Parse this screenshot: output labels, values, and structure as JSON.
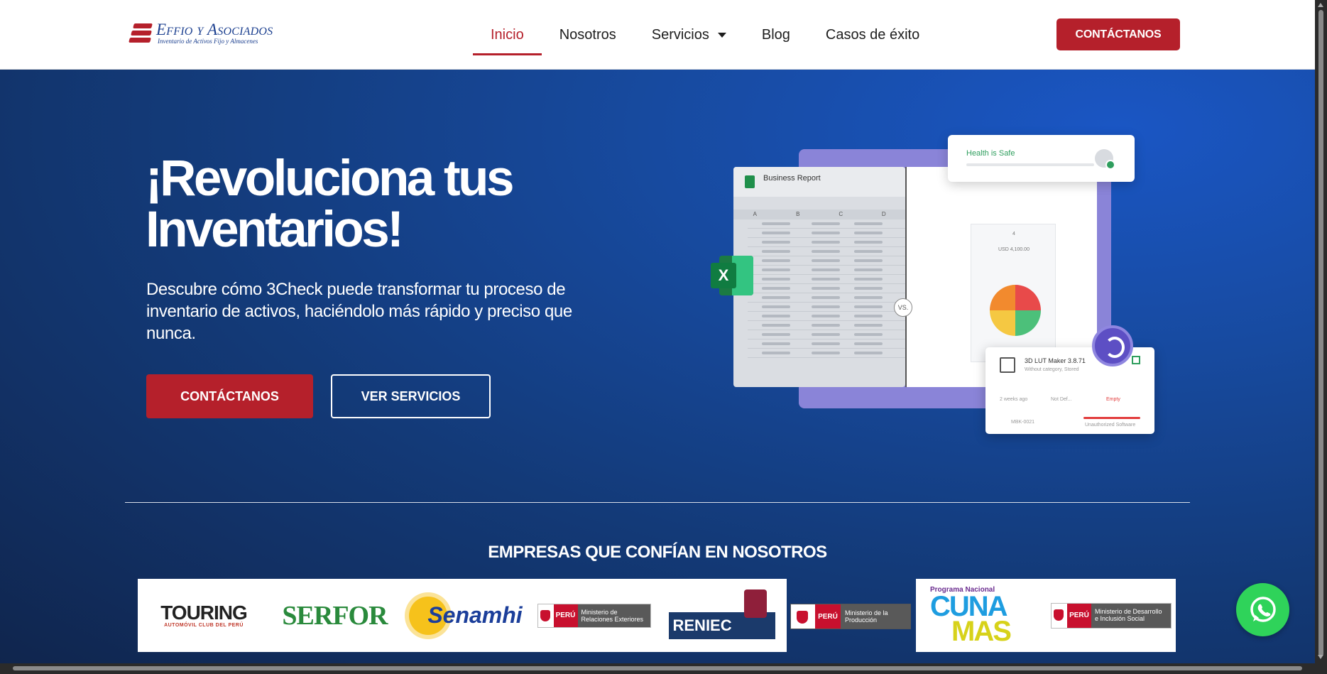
{
  "header": {
    "logo_name": "Effio y Asociados",
    "logo_tagline": "Inventario de Activos Fijo y Almacenes",
    "nav": [
      {
        "label": "Inicio",
        "active": true
      },
      {
        "label": "Nosotros",
        "active": false
      },
      {
        "label": "Servicios",
        "active": false,
        "dropdown": true
      },
      {
        "label": "Blog",
        "active": false
      },
      {
        "label": "Casos de éxito",
        "active": false
      }
    ],
    "cta_label": "CONTÁCTANOS"
  },
  "hero": {
    "title": "¡Revoluciona tus Inventarios!",
    "description": "Descubre cómo 3Check puede transformar tu proceso de inventario de activos, haciéndolo más rápido y preciso que nunca.",
    "primary_button": "CONTÁCTANOS",
    "secondary_button": "VER SERVICIOS"
  },
  "illustration": {
    "sheet_title": "Business Report",
    "sheet_columns": [
      "A",
      "B",
      "C",
      "D"
    ],
    "health_text": "Health is Safe",
    "vs_label": "VS.",
    "dash_total_assets": "4",
    "dash_value": "USD 4,100.00",
    "software_title": "3D LUT Maker 3.8.71",
    "software_sub": "Without category, Stored",
    "software_installed": "2 weeks ago",
    "software_manuf": "Not Def...",
    "software_license": "Empty",
    "software_id": "MBK-0021",
    "software_status": "Unauthorized Software",
    "excel_letter": "X"
  },
  "trust": {
    "title": "EMPRESAS QUE CONFÍAN EN NOSOTROS",
    "logos": {
      "touring_main": "TOURING",
      "touring_sub": "AUTOMÓVIL CLUB DEL PERÚ",
      "serfor": "SERFOR",
      "senamhi": "Senamhi",
      "peru_label": "PERÚ",
      "mrree": "Ministerio de Relaciones Exteriores",
      "reniec": "RENIEC",
      "produccion": "Ministerio de la Producción",
      "cuna_program": "Programa Nacional",
      "cuna_1": "CUNA",
      "cuna_2": "MAS",
      "midis": "Ministerio de Desarrollo e Inclusión Social"
    }
  },
  "colors": {
    "brand_red": "#b5202b",
    "brand_blue": "#1b3f8f",
    "whatsapp": "#2fd35a"
  },
  "icons": [
    "caret-down-icon",
    "whatsapp-icon",
    "excel-icon"
  ]
}
